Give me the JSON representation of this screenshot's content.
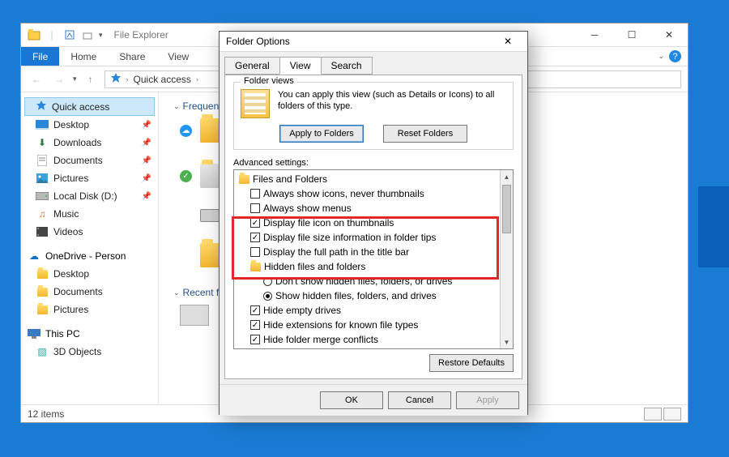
{
  "explorer": {
    "title": "File Explorer",
    "tabs": {
      "file": "File",
      "home": "Home",
      "share": "Share",
      "view": "View"
    },
    "breadcrumb": {
      "loc": "Quick access"
    },
    "sidebar": {
      "quick": "Quick access",
      "items": [
        "Desktop",
        "Downloads",
        "Documents",
        "Pictures",
        "Local Disk (D:)",
        "Music",
        "Videos"
      ],
      "onedrive": "OneDrive - Person",
      "od_items": [
        "Desktop",
        "Documents",
        "Pictures"
      ],
      "thispc": "This PC",
      "pc_items": [
        "3D Objects"
      ]
    },
    "sections": {
      "frequent": "Frequent folders",
      "recent": "Recent files"
    },
    "status": "12 items"
  },
  "dialog": {
    "title": "Folder Options",
    "tabs": [
      "General",
      "View",
      "Search"
    ],
    "folder_views": {
      "legend": "Folder views",
      "text": "You can apply this view (such as Details or Icons) to all folders of this type.",
      "apply": "Apply to Folders",
      "reset": "Reset Folders"
    },
    "advanced_label": "Advanced settings:",
    "tree": {
      "root": "Files and Folders",
      "l0": "Always show icons, never thumbnails",
      "l1": "Always show menus",
      "l2": "Display file icon on thumbnails",
      "l3": "Display file size information in folder tips",
      "l4": "Display the full path in the title bar",
      "hidden": "Hidden files and folders",
      "r0": "Don't show hidden files, folders, or drives",
      "r1": "Show hidden files, folders, and drives",
      "l5": "Hide empty drives",
      "l6": "Hide extensions for known file types",
      "l7": "Hide folder merge conflicts"
    },
    "restore": "Restore Defaults",
    "ok": "OK",
    "cancel": "Cancel",
    "apply": "Apply"
  }
}
